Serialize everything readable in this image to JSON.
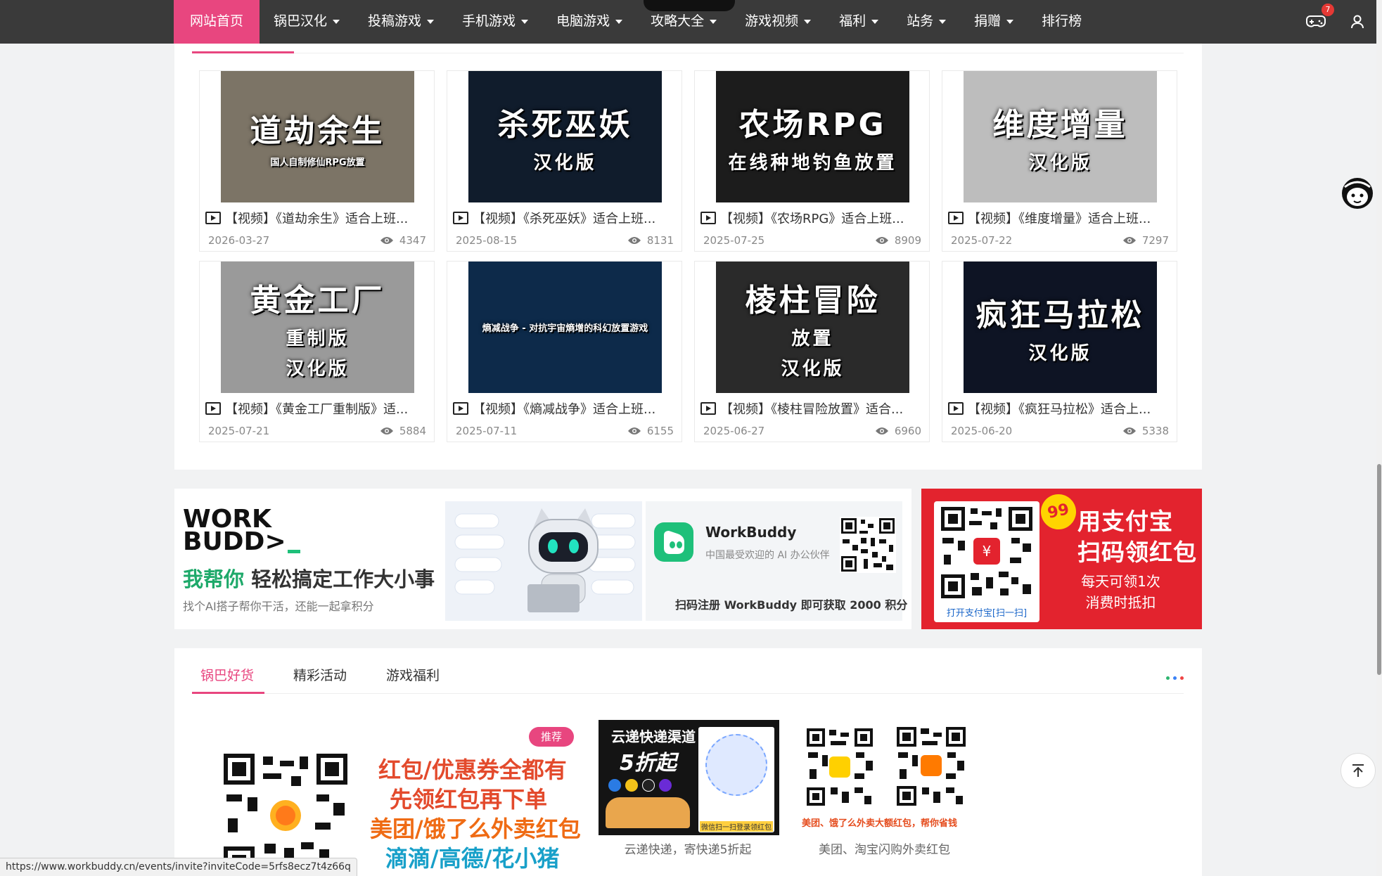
{
  "nav": {
    "items": [
      {
        "label": "网站首页",
        "active": true,
        "dropdown": false
      },
      {
        "label": "锅巴汉化",
        "dropdown": true
      },
      {
        "label": "投稿游戏",
        "dropdown": true
      },
      {
        "label": "手机游戏",
        "dropdown": true
      },
      {
        "label": "电脑游戏",
        "dropdown": true
      },
      {
        "label": "攻略大全",
        "dropdown": true
      },
      {
        "label": "游戏视频",
        "dropdown": true
      },
      {
        "label": "福利",
        "dropdown": true
      },
      {
        "label": "站务",
        "dropdown": true
      },
      {
        "label": "捐赠",
        "dropdown": true
      },
      {
        "label": "排行榜",
        "dropdown": false
      }
    ],
    "game_badge": "7",
    "icons": [
      "gamepad-icon",
      "user-icon"
    ]
  },
  "videos": [
    {
      "title": "【视频】《道劫余生》适合上班...",
      "date": "2026-03-27",
      "views": "4347",
      "thumb_line1": "道劫余生",
      "thumb_line2": "国人自制修仙RPG放置",
      "bg": "#7c7466"
    },
    {
      "title": "【视频】《杀死巫妖》适合上班...",
      "date": "2025-08-15",
      "views": "8131",
      "thumb_line1": "杀死巫妖",
      "thumb_line2": "汉化版",
      "bg": "#101c2c"
    },
    {
      "title": "【视频】《农场RPG》适合上班...",
      "date": "2025-07-25",
      "views": "8909",
      "thumb_line1": "农场RPG",
      "thumb_line2": "在线种地钓鱼放置",
      "bg": "#1c1c1c"
    },
    {
      "title": "【视频】《维度增量》适合上班...",
      "date": "2025-07-22",
      "views": "7297",
      "thumb_line1": "维度增量",
      "thumb_line2": "汉化版",
      "bg": "#bdbdbd"
    },
    {
      "title": "【视频】《黄金工厂重制版》适...",
      "date": "2025-07-21",
      "views": "5884",
      "thumb_line1": "黄金工厂",
      "thumb_line2": "重制版",
      "thumb_line3": "汉化版",
      "bg": "#9a9a9a"
    },
    {
      "title": "【视频】《熵减战争》适合上班...",
      "date": "2025-07-11",
      "views": "6155",
      "thumb_line1": "熵减战争 - 对抗宇宙熵增的科幻放置游戏",
      "thumb_line2": "",
      "bg": "#0d2a4a"
    },
    {
      "title": "【视频】《棱柱冒险放置》适合...",
      "date": "2025-06-27",
      "views": "6960",
      "thumb_line1": "棱柱冒险",
      "thumb_line2": "放置",
      "thumb_line3": "汉化版",
      "bg": "#2a2a2a"
    },
    {
      "title": "【视频】《疯狂马拉松》适合上...",
      "date": "2025-06-20",
      "views": "5338",
      "thumb_line1": "疯狂马拉松",
      "thumb_line2": "汉化版",
      "bg": "#0e1424"
    }
  ],
  "workbuddy": {
    "logo_line1": "WORK",
    "logo_line2": "BUDD>",
    "headline_green": "我帮你",
    "headline_black": "轻松搞定工作大小事",
    "sub": "找个AI搭子帮你干活，还能一起拿积分",
    "brand": "WorkBuddy",
    "slogan": "中国最受欢迎的 AI 办公伙伴",
    "footer": "扫码注册 WorkBuddy 即可获取 2000 积分"
  },
  "alipay": {
    "badge": "99",
    "line1": "用支付宝",
    "line2": "扫码领红包",
    "line3": "每天可领1次",
    "line4": "消费时抵扣",
    "qr_label": "打开支付宝[扫一扫]"
  },
  "goods": {
    "tabs": [
      "锅巴好货",
      "精彩活动",
      "游戏福利"
    ],
    "active_tab": 0,
    "tag": "推荐",
    "lines": [
      "红包/优惠券全都有",
      "先领红包再下单",
      "美团/饿了么外卖红包",
      "滴滴/高德/花小猪"
    ],
    "express_title": "云递快递渠道",
    "express_big": "5折起",
    "express_cap": "微信扫一扫登录领红包",
    "express_caption": "云递快递，寄快递5折起",
    "waimai_red": "美团、饿了么外卖大额红包，帮你省钱",
    "waimai_caption": "美团、淘宝闪购外卖红包"
  },
  "status_url": "https://www.workbuddy.cn/events/invite?inviteCode=5rfs8ecz7t4z66q",
  "colors": {
    "accent": "#e8467f",
    "nav_bg": "#3a3a3a",
    "alipay_red": "#e3232e",
    "workbuddy_green": "#1ec07a"
  }
}
